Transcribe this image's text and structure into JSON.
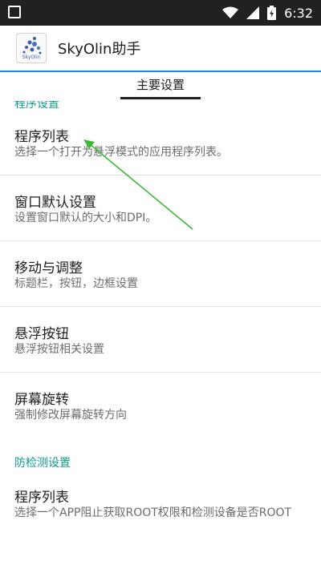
{
  "status_bar": {
    "time": "6:32",
    "icons": [
      "notification-square-icon",
      "wifi-icon",
      "signal-icon",
      "battery-icon"
    ]
  },
  "app_bar": {
    "icon_name": "skyolin-logo-icon",
    "icon_text": "SkyOlin",
    "title": "SkyOlin助手"
  },
  "tabs": [
    {
      "label": "主要设置",
      "selected": true
    }
  ],
  "sections": [
    {
      "header": "程序设置",
      "items": [
        {
          "title": "程序列表",
          "summary": "选择一个打开为悬浮模式的应用程序列表。"
        },
        {
          "title": "窗口默认设置",
          "summary": "设置窗口默认的大小和DPI。"
        },
        {
          "title": "移动与调整",
          "summary": "标题栏，按钮，边框设置"
        },
        {
          "title": "悬浮按钮",
          "summary": "悬浮按钮相关设置"
        },
        {
          "title": "屏幕旋转",
          "summary": "强制修改屏幕旋转方向"
        }
      ]
    },
    {
      "header": "防检测设置",
      "items": [
        {
          "title": "程序列表",
          "summary": "选择一个APP阻止获取ROOT权限和检测设备是否ROOT"
        }
      ]
    }
  ],
  "colors": {
    "accent": "#1e88e5",
    "section_header": "#0f9c8a",
    "annotation_arrow": "#3cb83c",
    "status_bar": "#212121"
  }
}
